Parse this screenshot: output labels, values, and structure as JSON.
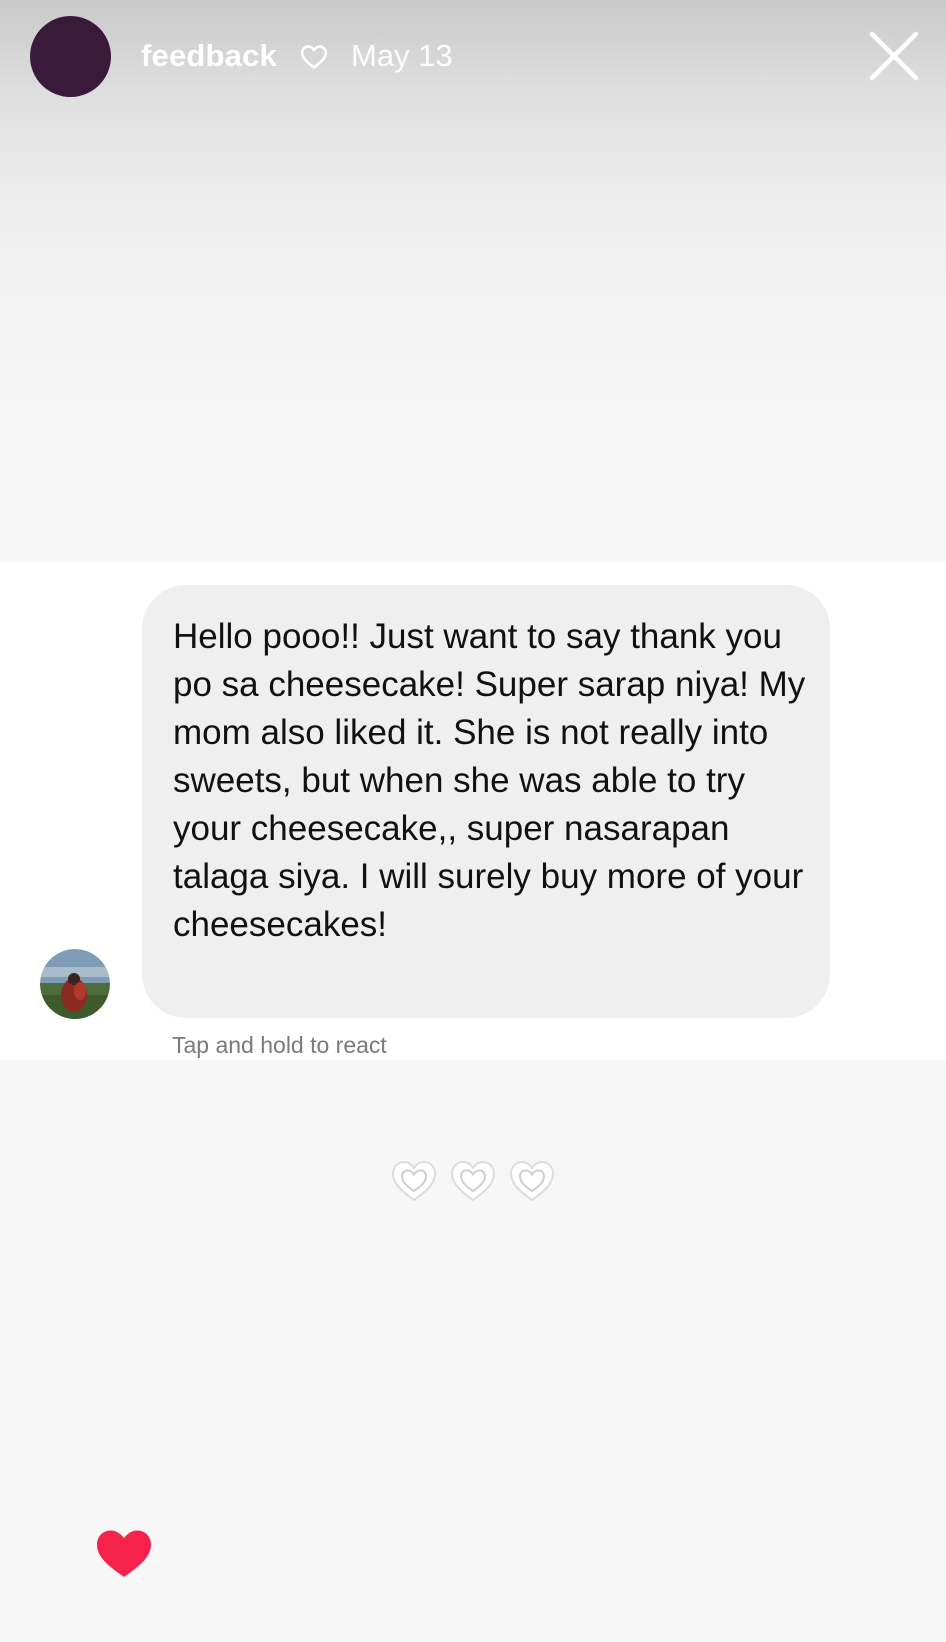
{
  "story": {
    "title": "feedback",
    "date": "May 13"
  },
  "message": {
    "text": "Hello pooo!! Just want to say thank you po sa cheesecake! Super sarap niya! My mom also liked it. She is not really into sweets, but when she was able to try your cheesecake,, super nasarapan talaga siya. I will surely buy more of your cheesecakes!",
    "hint": "Tap and hold to react"
  },
  "icons": {
    "highlight": "heart-outline-icon",
    "close": "close-icon",
    "decor_hearts": "heart-outline-icon",
    "like": "heart-filled-icon"
  },
  "colors": {
    "story_avatar": "#3a1a3a",
    "bubble": "#efefef",
    "like": "#f5224b"
  }
}
